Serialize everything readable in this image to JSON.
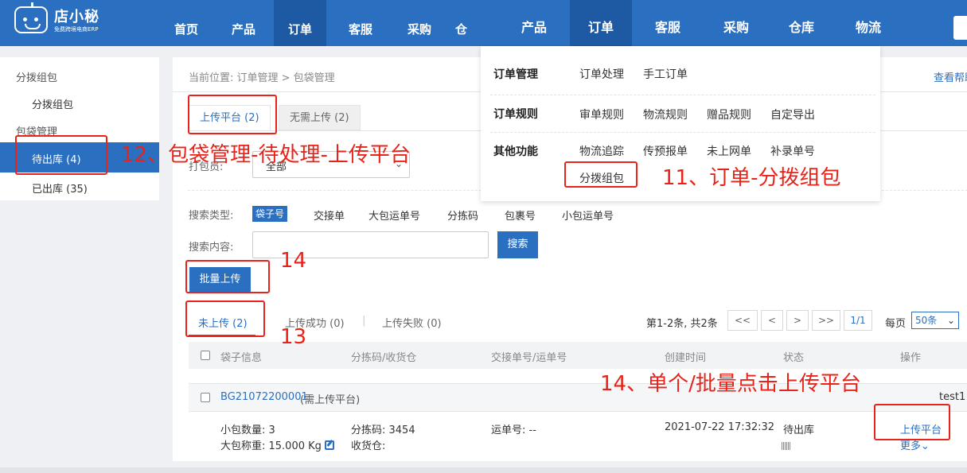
{
  "logo": {
    "title": "店小秘",
    "subtitle": "免费跨境电商ERP"
  },
  "nav": {
    "items": [
      "首页",
      "产品",
      "订单",
      "客服",
      "采购",
      "仓"
    ],
    "items2": [
      "产品",
      "订单",
      "客服",
      "采购",
      "仓库",
      "物流"
    ]
  },
  "sidebar": {
    "section1": "分拨组包",
    "item1": "分拨组包",
    "section2": "包袋管理",
    "item2": "待出库 (4)",
    "item3": "已出库 (35)"
  },
  "breadcrumb": "当前位置:  订单管理 > 包袋管理",
  "help_link": "查看帮助",
  "tabs": {
    "upload_platform": "上传平台 (2)",
    "no_upload": "无需上传 (2)"
  },
  "filter": {
    "packer_label": "打包员:",
    "packer_value": "全部"
  },
  "search": {
    "type_label": "搜索类型:",
    "types": [
      "袋子号",
      "交接单",
      "大包运单号",
      "分拣码",
      "包裹号",
      "小包运单号"
    ],
    "content_label": "搜索内容:",
    "button": "搜索"
  },
  "batch_upload": "批量上传",
  "status_tabs": {
    "not_uploaded": "未上传 (2)",
    "upload_success": "上传成功 (0)",
    "separator": "|",
    "upload_failed": "上传失败 (0)"
  },
  "pager": {
    "summary": "第1-2条, 共2条",
    "first": "<<",
    "prev": "<",
    "next": ">",
    "last": ">>",
    "page": "1/1",
    "per_page_label": "每页",
    "per_page_value": "50条"
  },
  "table": {
    "headers": [
      "袋子信息",
      "分拣码/收货仓",
      "交接单号/运单号",
      "创建时间",
      "状态",
      "操作"
    ],
    "row": {
      "bag_id": "BG21072200001",
      "bag_note": "(需上传平台)",
      "user": "test1",
      "small_count": "小包数量: 3",
      "big_weight": "大包称重:  15.000 Kg",
      "sort_code": "分拣码: 3454",
      "warehouse": "收货仓:",
      "waybill": "运单号: --",
      "created": "2021-07-22 17:32:32",
      "status": "待出库",
      "action": "上传平台",
      "more": "更多"
    }
  },
  "dropdown": {
    "rows": [
      {
        "label": "订单管理",
        "items": [
          "订单处理",
          "手工订单"
        ]
      },
      {
        "label": "订单规则",
        "items": [
          "审单规则",
          "物流规则",
          "赠品规则",
          "自定导出"
        ]
      },
      {
        "label": "其他功能",
        "items": [
          "物流追踪",
          "传预报单",
          "未上网单",
          "补录单号"
        ],
        "extra": "分拨组包"
      }
    ]
  },
  "annotations": {
    "a11": "11、订单-分拨组包",
    "a12": "12、包袋管理-待处理-上传平台",
    "a13": "13",
    "a14": "14",
    "a14b": "14、单个/批量点击上传平台"
  },
  "colors": {
    "primary": "#2b6fc0",
    "annotation": "#e8231a"
  }
}
